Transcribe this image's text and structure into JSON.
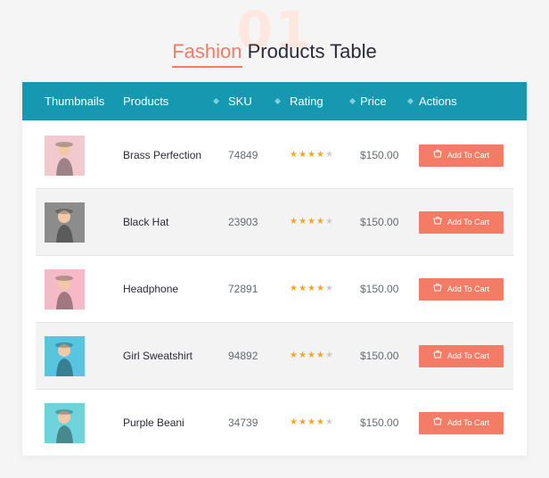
{
  "heading": {
    "number": "01",
    "title_accent": "Fashion",
    "title_rest": "Products Table"
  },
  "table": {
    "headers": [
      "Thumbnails",
      "Products",
      "SKU",
      "Rating",
      "Price",
      "Actions"
    ],
    "rows": [
      {
        "product": "Brass Perfection",
        "sku": "74849",
        "rating": 4,
        "rating_max": 5,
        "price": "$150.00",
        "action": "Add To Cart",
        "thumb_bg": "#f2c9cf",
        "thumb_icon": "woman-red-hat-photo"
      },
      {
        "product": "Black Hat",
        "sku": "23903",
        "rating": 4,
        "rating_max": 5,
        "price": "$150.00",
        "action": "Add To Cart",
        "thumb_bg": "#8c8c8c",
        "thumb_icon": "woman-black-hat-photo"
      },
      {
        "product": "Headphone",
        "sku": "72891",
        "rating": 4,
        "rating_max": 5,
        "price": "$150.00",
        "action": "Add To Cart",
        "thumb_bg": "#f6b9c8",
        "thumb_icon": "woman-pink-hair-photo"
      },
      {
        "product": "Girl Sweatshirt",
        "sku": "94892",
        "rating": 4,
        "rating_max": 5,
        "price": "$150.00",
        "action": "Add To Cart",
        "thumb_bg": "#58c4e0",
        "thumb_icon": "woman-yellow-top-photo"
      },
      {
        "product": "Purple Beani",
        "sku": "34739",
        "rating": 4,
        "rating_max": 5,
        "price": "$150.00",
        "action": "Add To Cart",
        "thumb_bg": "#6fd3dc",
        "thumb_icon": "woman-purple-beanie-photo"
      }
    ]
  },
  "colors": {
    "accent": "#f47c66",
    "header_bg": "#1598b0",
    "star_filled": "#f5a623",
    "star_empty": "#cccccc"
  }
}
